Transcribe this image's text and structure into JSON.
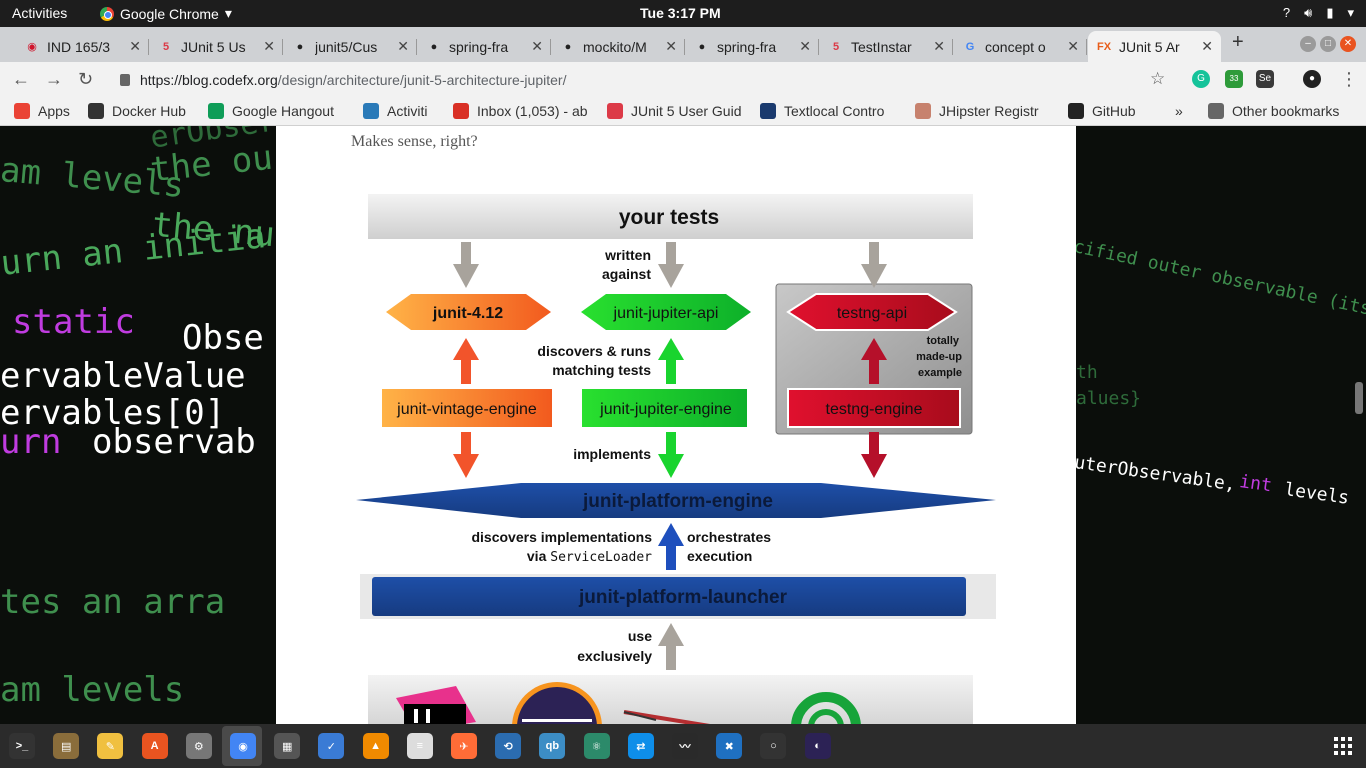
{
  "topbar": {
    "activities": "Activities",
    "app_name": "Google Chrome",
    "clock": "Tue  3:17 PM",
    "sys_icons": [
      "help-icon",
      "volume-icon",
      "battery-icon",
      "power-menu-icon"
    ],
    "help": "?"
  },
  "tabs": [
    {
      "title": "IND 165/3",
      "icon": "cricket-icon",
      "color": "#d0142b",
      "glyph": "◉"
    },
    {
      "title": "JUnit 5 Us",
      "icon": "junit5-icon",
      "color": "#dc3a47",
      "glyph": "5"
    },
    {
      "title": "junit5/Cus",
      "icon": "github-icon",
      "color": "#222222",
      "glyph": "●"
    },
    {
      "title": "spring-fra",
      "icon": "github-icon",
      "color": "#222222",
      "glyph": "●"
    },
    {
      "title": "mockito/M",
      "icon": "github-icon",
      "color": "#222222",
      "glyph": "●"
    },
    {
      "title": "spring-fra",
      "icon": "github-icon",
      "color": "#222222",
      "glyph": "●"
    },
    {
      "title": "TestInstar",
      "icon": "junit5-icon",
      "color": "#dc3a47",
      "glyph": "5"
    },
    {
      "title": "concept o",
      "icon": "google-icon",
      "color": "#4285f4",
      "glyph": "G"
    },
    {
      "title": "JUnit 5 Ar",
      "icon": "codefx-icon",
      "color": "#e85d1a",
      "glyph": "FX"
    }
  ],
  "toolbar": {
    "url_host": "https://blog.codefx.org",
    "url_path": "/design/architecture/junit-5-architecture-jupiter/",
    "badge_count": "33"
  },
  "bookmarks": [
    {
      "label": "Apps",
      "icon": "apps-grid-icon",
      "color": "#ea4335"
    },
    {
      "label": "Docker Hub",
      "icon": "docker-icon",
      "color": "#333333"
    },
    {
      "label": "Google Hangout",
      "icon": "hangouts-icon",
      "color": "#0f9d58"
    },
    {
      "label": "Activiti",
      "icon": "activiti-icon",
      "color": "#2a7ab8"
    },
    {
      "label": "Inbox (1,053) - ab",
      "icon": "gmail-icon",
      "color": "#d93025"
    },
    {
      "label": "JUnit 5 User Guid",
      "icon": "junit5-icon",
      "color": "#dc3a47"
    },
    {
      "label": "Textlocal Contro",
      "icon": "textlocal-icon",
      "color": "#1a3a6e"
    },
    {
      "label": "JHipster Registr",
      "icon": "jhipster-icon",
      "color": "#c7826e"
    },
    {
      "label": "GitHub",
      "icon": "github-icon",
      "color": "#222222"
    }
  ],
  "bookmarks_overflow": "»",
  "other_bookmarks": "Other bookmarks",
  "page": {
    "intro": "Makes sense, right?"
  },
  "diagram": {
    "your_tests": "your tests",
    "written_against_1": "written",
    "written_against_2": "against",
    "junit412": "junit-4.12",
    "jupiter_api": "junit-jupiter-api",
    "testng_api": "testng-api",
    "made_up_1": "totally",
    "made_up_2": "made-up",
    "made_up_3": "example",
    "discovers_runs_1": "discovers & runs",
    "discovers_runs_2": "matching tests",
    "vintage_engine": "junit-vintage-engine",
    "jupiter_engine": "junit-jupiter-engine",
    "testng_engine": "testng-engine",
    "implements": "implements",
    "platform_engine": "junit-platform-engine",
    "discovers_impl_1": "discovers implementations",
    "discovers_impl_2": "via",
    "service_loader": "ServiceLoader",
    "orchestrates_1": "orchestrates",
    "orchestrates_2": "execution",
    "platform_launcher": "junit-platform-launcher",
    "use_1": "use",
    "use_2": "exclusively"
  },
  "bg_left_code": [
    {
      "text": "erObser",
      "color": "#2e6b3a"
    },
    {
      "text": "the ou",
      "color": "#3f8f4e"
    },
    {
      "text": "am levels",
      "color": "#3f8f4e"
    },
    {
      "text": "the nu",
      "color": "#4aa85b"
    },
    {
      "text": "urn an initia",
      "color": "#4aa85b"
    },
    {
      "text": "static",
      "color": "#c03ce0"
    },
    {
      "text": "Obse",
      "color": "#ffffff"
    },
    {
      "text": "ervableValue",
      "color": "#ffffff"
    },
    {
      "text": "ervables[0]",
      "color": "#ffffff"
    },
    {
      "text": "urn",
      "color": "#c03ce0"
    },
    {
      "text": "observab",
      "color": "#ffffff"
    },
    {
      "text": "tes an arra",
      "color": "#3f8f4e"
    },
    {
      "text": "am levels",
      "color": "#3f8f4e"
    }
  ],
  "bg_right_code": [
    {
      "text": "cified outer observable (its",
      "color": "#3f8f4e"
    },
    {
      "text": "th",
      "color": "#2e6b3a"
    },
    {
      "text": "alues}",
      "color": "#2e6b3a"
    },
    {
      "text": "uterObservable,",
      "color": "#ffffff"
    },
    {
      "text": "int",
      "color": "#c03ce0"
    },
    {
      "text": "levels",
      "color": "#ffffff"
    }
  ],
  "taskbar": [
    {
      "name": "terminal-icon",
      "color": "#333333",
      "glyph": ">_"
    },
    {
      "name": "files-icon",
      "color": "#8a6d3b",
      "glyph": "▤"
    },
    {
      "name": "text-editor-icon",
      "color": "#f0c040",
      "glyph": "✎"
    },
    {
      "name": "software-center-icon",
      "color": "#e95420",
      "glyph": "A"
    },
    {
      "name": "settings-icon",
      "color": "#777777",
      "glyph": "⚙"
    },
    {
      "name": "chrome-icon",
      "color": "#4285f4",
      "glyph": "◉"
    },
    {
      "name": "calculator-icon",
      "color": "#555555",
      "glyph": "▦"
    },
    {
      "name": "tasks-icon",
      "color": "#3a7bd5",
      "glyph": "✓"
    },
    {
      "name": "vlc-icon",
      "color": "#f08a00",
      "glyph": "▲"
    },
    {
      "name": "document-viewer-icon",
      "color": "#dddddd",
      "glyph": "≡"
    },
    {
      "name": "postman-icon",
      "color": "#ff6c37",
      "glyph": "✈"
    },
    {
      "name": "network-icon",
      "color": "#2b6cb0",
      "glyph": "⟲"
    },
    {
      "name": "qbittorrent-icon",
      "color": "#3c8dc5",
      "glyph": "qb"
    },
    {
      "name": "atom-icon",
      "color": "#2c8a6a",
      "glyph": "⚛"
    },
    {
      "name": "teamviewer-icon",
      "color": "#0e8ee9",
      "glyph": "⇄"
    },
    {
      "name": "system-monitor-icon",
      "color": "#2a2a2a",
      "glyph": "〰"
    },
    {
      "name": "sts-icon",
      "color": "#1f70c1",
      "glyph": "✖"
    },
    {
      "name": "obs-icon",
      "color": "#333333",
      "glyph": "○"
    },
    {
      "name": "eclipse-icon",
      "color": "#2c2255",
      "glyph": "◐"
    }
  ]
}
